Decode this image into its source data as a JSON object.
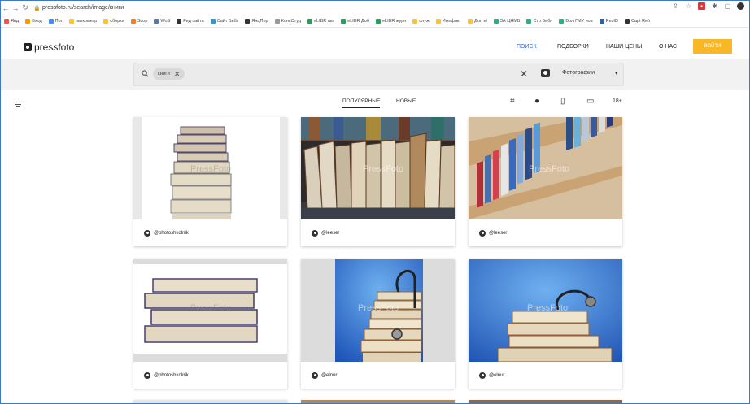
{
  "browser": {
    "url": "pressfoto.ru/search/image/книги",
    "bookmarks": [
      "Янд",
      "Вход",
      "Пог",
      "наукометр",
      "сборка",
      "Scop",
      "WoS",
      "Ред сайта",
      "Сайт Бибх",
      "ЯнцПер",
      "КонсСтуд",
      "eLIBR авт",
      "eLIBR Доб",
      "eLIBR журн",
      "служ",
      "Импфакт",
      "Доп el",
      "ЗА ЦНМБ",
      "Стр Библ",
      "ВолгГМУ нов",
      "ResID",
      "Capt Refr"
    ]
  },
  "header": {
    "logo_text": "pressfoto",
    "nav": {
      "search": "ПОИСК",
      "collections": "ПОДБОРКИ",
      "prices": "НАШИ ЦЕНЫ",
      "about": "О НАС"
    },
    "login": "ВОЙТИ"
  },
  "search": {
    "query_chip": "книги",
    "type_select": "Фотографии"
  },
  "filters": {
    "popular": "ПОПУЛЯРНЫЕ",
    "new": "НОВЫЕ",
    "age": "18+"
  },
  "watermark": "PressFoto",
  "cards": [
    {
      "author": "@photoshkolnik"
    },
    {
      "author": "@leeser"
    },
    {
      "author": "@leeser"
    },
    {
      "author": "@photoshkolnik"
    },
    {
      "author": "@elnur"
    },
    {
      "author": "@elnur"
    }
  ],
  "colors": {
    "accent": "#3b6fd4",
    "login_bg": "#f7b726",
    "frame": "#3d78c9"
  }
}
